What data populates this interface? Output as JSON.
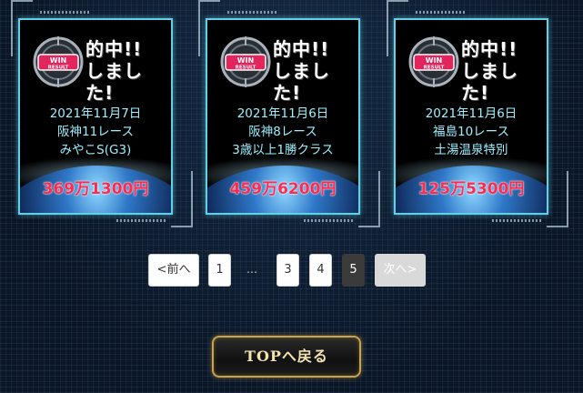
{
  "colors": {
    "accent_cyan": "#62d0e6",
    "prize_red": "#ff2a4e",
    "info_text": "#9bf0ff",
    "gold": "#c9a24a"
  },
  "cards": [
    {
      "badge_win": "WIN",
      "badge_result": "RESULT",
      "headline_line1": "的中!!",
      "headline_line2": "しました!",
      "date": "2021年11月7日",
      "race": "阪神11レース",
      "race_name": "みやこS(G3)",
      "prize": "369万1300円"
    },
    {
      "badge_win": "WIN",
      "badge_result": "RESULT",
      "headline_line1": "的中!!",
      "headline_line2": "しました!",
      "date": "2021年11月6日",
      "race": "阪神8レース",
      "race_name": "3歳以上1勝クラス",
      "prize": "459万6200円"
    },
    {
      "badge_win": "WIN",
      "badge_result": "RESULT",
      "headline_line1": "的中!!",
      "headline_line2": "しました!",
      "date": "2021年11月6日",
      "race": "福島10レース",
      "race_name": "土湯温泉特別",
      "prize": "125万5300円"
    }
  ],
  "pagination": {
    "prev": "<前へ",
    "page1": "1",
    "ellipsis": "…",
    "page3": "3",
    "page4": "4",
    "page5": "5",
    "next": "次へ>",
    "current_page": 5
  },
  "top_button": "TOPへ戻る"
}
